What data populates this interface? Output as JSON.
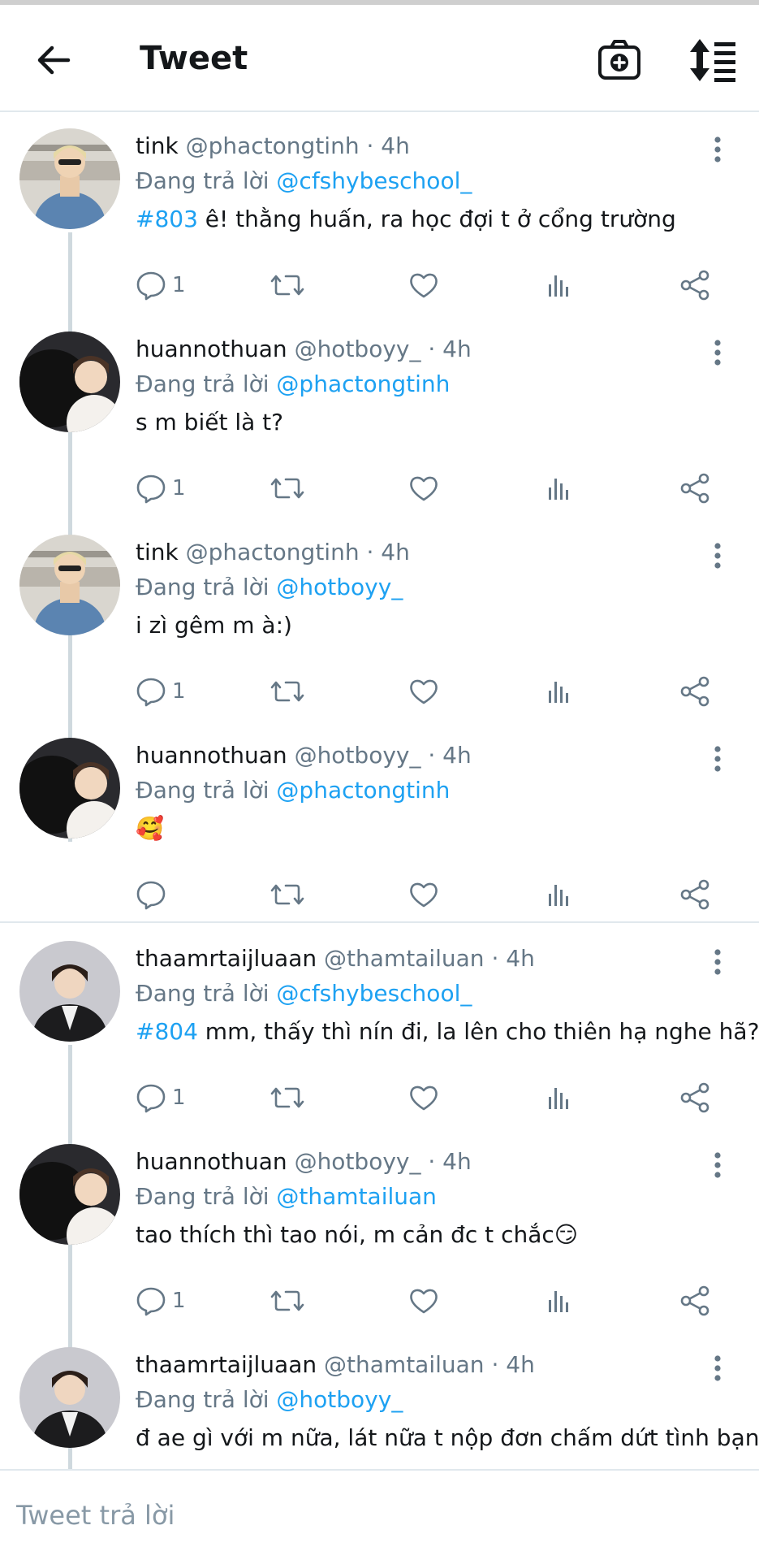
{
  "header": {
    "title": "Tweet",
    "back_icon": "arrow-left-icon",
    "camera_icon": "camera-plus-icon",
    "sort_icon": "sort-list-icon"
  },
  "colors": {
    "accent": "#1da1f2",
    "muted": "#657786",
    "text": "#14171a",
    "divider": "#e1e8ed"
  },
  "reply_prefix": "Đang trả lời",
  "tweets": [
    {
      "display_name": "tink",
      "handle": "@phactongtinh",
      "time": "· 4h",
      "reply_to": "@cfshybeschool_",
      "hashtag": "#803",
      "text": " ê! thằng huấn, ra học đợi t ở cổng trường",
      "reply_count": "1"
    },
    {
      "display_name": "huannothuan",
      "handle": "@hotboyy_",
      "time": "· 4h",
      "reply_to": "@phactongtinh",
      "hashtag": "",
      "text": "s m biết là t?",
      "reply_count": "1"
    },
    {
      "display_name": "tink",
      "handle": "@phactongtinh",
      "time": "· 4h",
      "reply_to": "@hotboyy_",
      "hashtag": "",
      "text": "i zì gêm m à:)",
      "reply_count": "1"
    },
    {
      "display_name": "huannothuan",
      "handle": "@hotboyy_",
      "time": "· 4h",
      "reply_to": "@phactongtinh",
      "hashtag": "",
      "text": "🥰",
      "reply_count": ""
    },
    {
      "display_name": "thaamrtaijluaan",
      "handle": "@thamtailuan",
      "time": "· 4h",
      "reply_to": "@cfshybeschool_",
      "hashtag": "#804",
      "text": " mm, thấy thì nín đi, la lên cho thiên hạ nghe hã?",
      "reply_count": "1"
    },
    {
      "display_name": "huannothuan",
      "handle": "@hotboyy_",
      "time": "· 4h",
      "reply_to": "@thamtailuan",
      "hashtag": "",
      "text": "tao thích thì tao nói, m cản đc t chắc😏",
      "reply_count": "1"
    },
    {
      "display_name": "thaamrtaijluaan",
      "handle": "@thamtailuan",
      "time": "· 4h",
      "reply_to": "@hotboyy_",
      "hashtag": "",
      "text": "đ ae gì với m nữa, lát nữa t nộp đơn chấm dứt tình bạn,",
      "reply_count": ""
    }
  ],
  "icons": {
    "reply": "reply-icon",
    "retweet": "retweet-icon",
    "like": "heart-icon",
    "views": "analytics-icon",
    "share": "share-icon",
    "more": "more-vertical-icon"
  },
  "compose": {
    "placeholder": "Tweet trả lời"
  }
}
